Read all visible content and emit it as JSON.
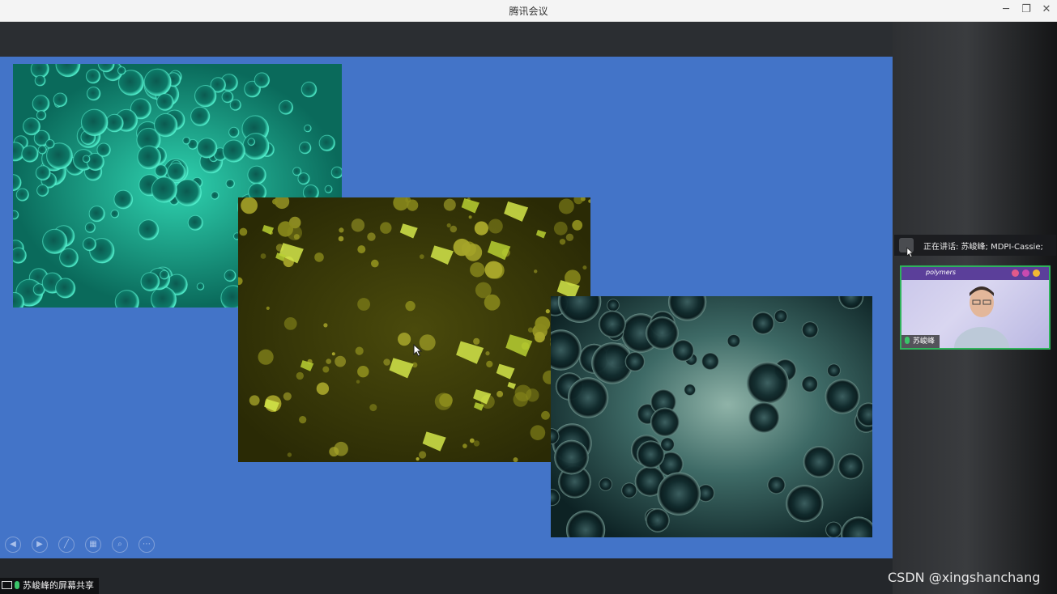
{
  "window": {
    "title": "腾讯会议",
    "minimize_icon": "minimize-icon",
    "restore_icon": "restore-icon",
    "close_icon": "close-icon"
  },
  "speaker_bar": {
    "text": "正在讲话: 苏峻峰; MDPI-Cassie;"
  },
  "video_tile": {
    "participant_name": "苏峻峰",
    "banner_text": "polymers"
  },
  "slide_controls": [
    {
      "icon": "previous-icon",
      "glyph": "◀"
    },
    {
      "icon": "next-icon",
      "glyph": "▶"
    },
    {
      "icon": "pen-icon",
      "glyph": "╱"
    },
    {
      "icon": "slides-icon",
      "glyph": "▦"
    },
    {
      "icon": "zoom-icon",
      "glyph": "⌕"
    },
    {
      "icon": "more-icon",
      "glyph": "⋯"
    }
  ],
  "screen_share": {
    "label": "苏峻峰的屏幕共享"
  },
  "watermark": "CSDN @xingshanchang",
  "colors": {
    "slide_background": "#4374c8",
    "active_speaker_border": "#2fb35b"
  }
}
